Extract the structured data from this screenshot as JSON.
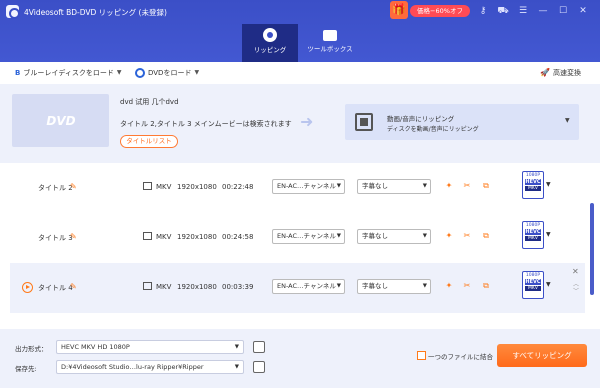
{
  "window": {
    "title": "4Videosoft BD-DVD リッピング (未登録)",
    "promo_label": "価格−60%オフ",
    "icons": [
      "key-icon",
      "cart-icon",
      "menu-icon",
      "minimize-icon",
      "maximize-icon",
      "close-icon"
    ]
  },
  "main_tabs": [
    {
      "label": "リッピング",
      "active": true
    },
    {
      "label": "ツールボックス",
      "active": false
    }
  ],
  "toolbar": {
    "load_bluray": "ブルーレイディスクをロード",
    "load_dvd": "DVDをロード",
    "fast_convert": "高速変換"
  },
  "source": {
    "disc_label": "DVD",
    "name": "dvd 试用 几个dvd",
    "description": "タイトル 2,タイトル 3 メインムービーは検索されます",
    "title_list_button": "タイトルリスト",
    "profile_title": "動画/音声にリッピング",
    "profile_subtitle": "ディスクを動画/音声にリッピング"
  },
  "titles": [
    {
      "name": "タイトル 2",
      "format": "MKV",
      "resolution": "1920x1080",
      "duration": "00:22:48",
      "audio": "EN-AC…チャンネル",
      "subtitle": "字幕なし",
      "output": {
        "line1": "1080P",
        "line2": "HEVC",
        "line3": "MKV"
      },
      "selected": false
    },
    {
      "name": "タイトル 3",
      "format": "MKV",
      "resolution": "1920x1080",
      "duration": "00:24:58",
      "audio": "EN-AC…チャンネル",
      "subtitle": "字幕なし",
      "output": {
        "line1": "1080P",
        "line2": "HEVC",
        "line3": "MKV"
      },
      "selected": false
    },
    {
      "name": "タイトル 4",
      "format": "MKV",
      "resolution": "1920x1080",
      "duration": "00:03:39",
      "audio": "EN-AC…チャンネル",
      "subtitle": "字幕なし",
      "output": {
        "line1": "1080P",
        "line2": "HEVC",
        "line3": "MKV"
      },
      "selected": true
    }
  ],
  "bottom": {
    "output_format_label": "出力形式：",
    "output_format_value": "HEVC MKV HD 1080P",
    "save_to_label": "保存先:",
    "save_to_value": "D:¥4Videosoft Studio…lu-ray Ripper¥Ripper",
    "merge_label": "一つのファイルに結合",
    "merge_checked": false,
    "rip_all_button": "すべてリッピング"
  },
  "colors": {
    "titlebar": "#3b4fc7",
    "active_tab": "#1f2c86",
    "accent": "#ff6a1a",
    "panel": "#eef1fb"
  }
}
